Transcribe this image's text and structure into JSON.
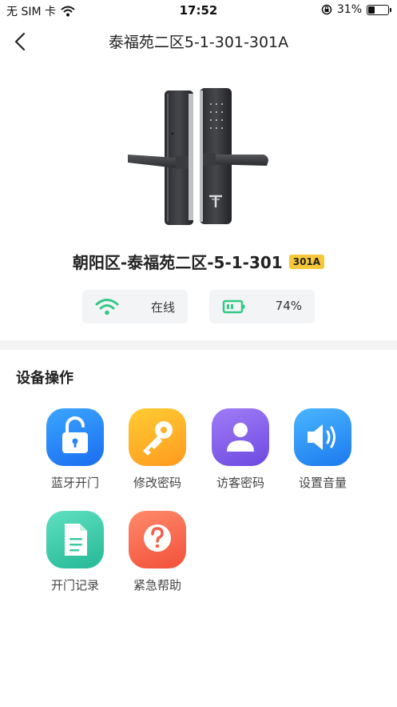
{
  "status_bar": {
    "carrier": "无 SIM 卡",
    "time": "17:52",
    "battery_percent": "31%",
    "battery_level": 0.31
  },
  "nav": {
    "title": "泰福苑二区5-1-301-301A"
  },
  "device": {
    "name": "朝阳区-泰福苑二区-5-1-301",
    "room_badge": "301A",
    "online_status": "在线",
    "battery": "74%"
  },
  "section": {
    "title": "设备操作"
  },
  "operations": [
    {
      "label": "蓝牙开门",
      "icon": "unlock-icon",
      "color_from": "#3aa6ff",
      "color_to": "#1a6cf0"
    },
    {
      "label": "修改密码",
      "icon": "key-icon",
      "color_from": "#ffcc33",
      "color_to": "#ff9a1f"
    },
    {
      "label": "访客密码",
      "icon": "visitor-icon",
      "color_from": "#a07cf7",
      "color_to": "#6d4ae0"
    },
    {
      "label": "设置音量",
      "icon": "speaker-icon",
      "color_from": "#4ab6ff",
      "color_to": "#1b79ee"
    },
    {
      "label": "开门记录",
      "icon": "record-icon",
      "color_from": "#5fe0c0",
      "color_to": "#25b897"
    },
    {
      "label": "紧急帮助",
      "icon": "help-icon",
      "color_from": "#ff8a6a",
      "color_to": "#f2503b"
    }
  ],
  "colors": {
    "online_green": "#33c985",
    "badge_yellow": "#f6c839"
  }
}
